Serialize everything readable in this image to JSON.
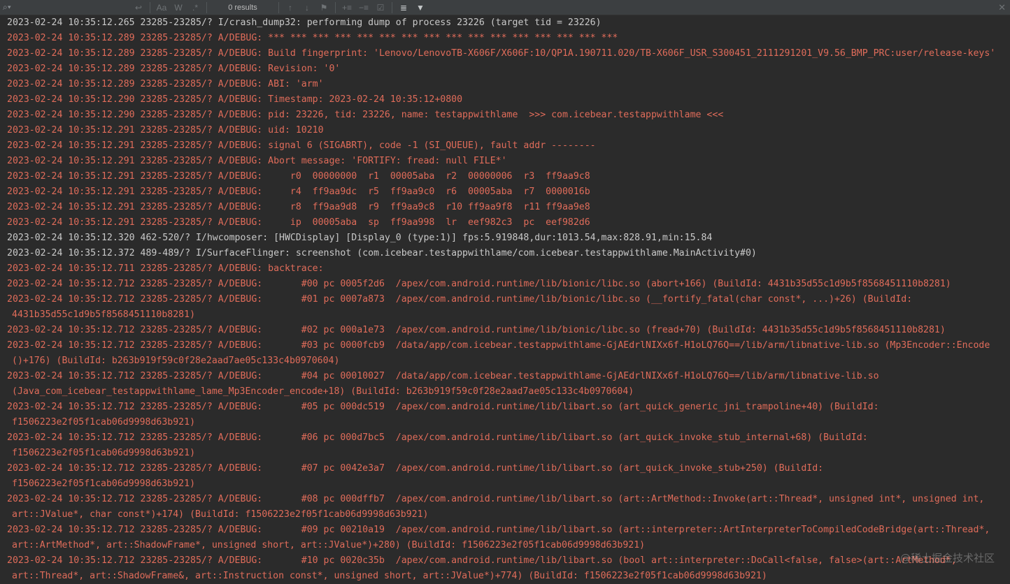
{
  "toolbar": {
    "search_icon": "search-icon",
    "search_value": "",
    "results_label": "0 results",
    "match_case_label": "Aa",
    "words_label": "W",
    "regex_label": ".*"
  },
  "log_lines": [
    {
      "text": "2023-02-24 10:35:12.265 23285-23285/? I/crash_dump32: performing dump of process 23226 (target tid = 23226)",
      "level": "info"
    },
    {
      "text": "2023-02-24 10:35:12.289 23285-23285/? A/DEBUG: *** *** *** *** *** *** *** *** *** *** *** *** *** *** *** ***",
      "level": "err"
    },
    {
      "text": "2023-02-24 10:35:12.289 23285-23285/? A/DEBUG: Build fingerprint: 'Lenovo/LenovoTB-X606F/X606F:10/QP1A.190711.020/TB-X606F_USR_S300451_2111291201_V9.56_BMP_PRC:user/release-keys'",
      "level": "err"
    },
    {
      "text": "2023-02-24 10:35:12.289 23285-23285/? A/DEBUG: Revision: '0'",
      "level": "err"
    },
    {
      "text": "2023-02-24 10:35:12.289 23285-23285/? A/DEBUG: ABI: 'arm'",
      "level": "err"
    },
    {
      "text": "2023-02-24 10:35:12.290 23285-23285/? A/DEBUG: Timestamp: 2023-02-24 10:35:12+0800",
      "level": "err"
    },
    {
      "text": "2023-02-24 10:35:12.290 23285-23285/? A/DEBUG: pid: 23226, tid: 23226, name: testappwithlame  >>> com.icebear.testappwithlame <<<",
      "level": "err"
    },
    {
      "text": "2023-02-24 10:35:12.291 23285-23285/? A/DEBUG: uid: 10210",
      "level": "err"
    },
    {
      "text": "2023-02-24 10:35:12.291 23285-23285/? A/DEBUG: signal 6 (SIGABRT), code -1 (SI_QUEUE), fault addr --------",
      "level": "err"
    },
    {
      "text": "2023-02-24 10:35:12.291 23285-23285/? A/DEBUG: Abort message: 'FORTIFY: fread: null FILE*'",
      "level": "err"
    },
    {
      "text": "2023-02-24 10:35:12.291 23285-23285/? A/DEBUG:     r0  00000000  r1  00005aba  r2  00000006  r3  ff9aa9c8",
      "level": "err"
    },
    {
      "text": "2023-02-24 10:35:12.291 23285-23285/? A/DEBUG:     r4  ff9aa9dc  r5  ff9aa9c0  r6  00005aba  r7  0000016b",
      "level": "err"
    },
    {
      "text": "2023-02-24 10:35:12.291 23285-23285/? A/DEBUG:     r8  ff9aa9d8  r9  ff9aa9c8  r10 ff9aa9f8  r11 ff9aa9e8",
      "level": "err"
    },
    {
      "text": "2023-02-24 10:35:12.291 23285-23285/? A/DEBUG:     ip  00005aba  sp  ff9aa998  lr  eef982c3  pc  eef982d6",
      "level": "err"
    },
    {
      "text": "2023-02-24 10:35:12.320 462-520/? I/hwcomposer: [HWCDisplay] [Display_0 (type:1)] fps:5.919848,dur:1013.54,max:828.91,min:15.84",
      "level": "info"
    },
    {
      "text": "2023-02-24 10:35:12.372 489-489/? I/SurfaceFlinger: screenshot (com.icebear.testappwithlame/com.icebear.testappwithlame.MainActivity#0)",
      "level": "info"
    },
    {
      "text": "2023-02-24 10:35:12.711 23285-23285/? A/DEBUG: backtrace:",
      "level": "err"
    },
    {
      "text": "2023-02-24 10:35:12.712 23285-23285/? A/DEBUG:       #00 pc 0005f2d6  /apex/com.android.runtime/lib/bionic/libc.so (abort+166) (BuildId: 4431b35d55c1d9b5f8568451110b8281)",
      "level": "err"
    },
    {
      "text": "2023-02-24 10:35:12.712 23285-23285/? A/DEBUG:       #01 pc 0007a873  /apex/com.android.runtime/lib/bionic/libc.so (__fortify_fatal(char const*, ...)+26) (BuildId:",
      "level": "err"
    },
    {
      "text": "4431b35d55c1d9b5f8568451110b8281)",
      "level": "err",
      "cont": true
    },
    {
      "text": "2023-02-24 10:35:12.712 23285-23285/? A/DEBUG:       #02 pc 000a1e73  /apex/com.android.runtime/lib/bionic/libc.so (fread+70) (BuildId: 4431b35d55c1d9b5f8568451110b8281)",
      "level": "err"
    },
    {
      "text": "2023-02-24 10:35:12.712 23285-23285/? A/DEBUG:       #03 pc 0000fcb9  /data/app/com.icebear.testappwithlame-GjAEdrlNIXx6f-H1oLQ76Q==/lib/arm/libnative-lib.so (Mp3Encoder::Encode",
      "level": "err"
    },
    {
      "text": "()+176) (BuildId: b263b919f59c0f28e2aad7ae05c133c4b0970604)",
      "level": "err",
      "cont": true
    },
    {
      "text": "2023-02-24 10:35:12.712 23285-23285/? A/DEBUG:       #04 pc 00010027  /data/app/com.icebear.testappwithlame-GjAEdrlNIXx6f-H1oLQ76Q==/lib/arm/libnative-lib.so",
      "level": "err"
    },
    {
      "text": "(Java_com_icebear_testappwithlame_lame_Mp3Encoder_encode+18) (BuildId: b263b919f59c0f28e2aad7ae05c133c4b0970604)",
      "level": "err",
      "cont": true
    },
    {
      "text": "2023-02-24 10:35:12.712 23285-23285/? A/DEBUG:       #05 pc 000dc519  /apex/com.android.runtime/lib/libart.so (art_quick_generic_jni_trampoline+40) (BuildId:",
      "level": "err"
    },
    {
      "text": "f1506223e2f05f1cab06d9998d63b921)",
      "level": "err",
      "cont": true
    },
    {
      "text": "2023-02-24 10:35:12.712 23285-23285/? A/DEBUG:       #06 pc 000d7bc5  /apex/com.android.runtime/lib/libart.so (art_quick_invoke_stub_internal+68) (BuildId:",
      "level": "err"
    },
    {
      "text": "f1506223e2f05f1cab06d9998d63b921)",
      "level": "err",
      "cont": true
    },
    {
      "text": "2023-02-24 10:35:12.712 23285-23285/? A/DEBUG:       #07 pc 0042e3a7  /apex/com.android.runtime/lib/libart.so (art_quick_invoke_stub+250) (BuildId:",
      "level": "err"
    },
    {
      "text": "f1506223e2f05f1cab06d9998d63b921)",
      "level": "err",
      "cont": true
    },
    {
      "text": "2023-02-24 10:35:12.712 23285-23285/? A/DEBUG:       #08 pc 000dffb7  /apex/com.android.runtime/lib/libart.so (art::ArtMethod::Invoke(art::Thread*, unsigned int*, unsigned int,",
      "level": "err"
    },
    {
      "text": "art::JValue*, char const*)+174) (BuildId: f1506223e2f05f1cab06d9998d63b921)",
      "level": "err",
      "cont": true
    },
    {
      "text": "2023-02-24 10:35:12.712 23285-23285/? A/DEBUG:       #09 pc 00210a19  /apex/com.android.runtime/lib/libart.so (art::interpreter::ArtInterpreterToCompiledCodeBridge(art::Thread*,",
      "level": "err"
    },
    {
      "text": "art::ArtMethod*, art::ShadowFrame*, unsigned short, art::JValue*)+280) (BuildId: f1506223e2f05f1cab06d9998d63b921)",
      "level": "err",
      "cont": true
    },
    {
      "text": "2023-02-24 10:35:12.712 23285-23285/? A/DEBUG:       #10 pc 0020c35b  /apex/com.android.runtime/lib/libart.so (bool art::interpreter::DoCall<false, false>(art::ArtMethod*,",
      "level": "err"
    },
    {
      "text": "art::Thread*, art::ShadowFrame&, art::Instruction const*, unsigned short, art::JValue*)+774) (BuildId: f1506223e2f05f1cab06d9998d63b921)",
      "level": "err",
      "cont": true
    }
  ],
  "watermark": "@稀土掘金技术社区"
}
